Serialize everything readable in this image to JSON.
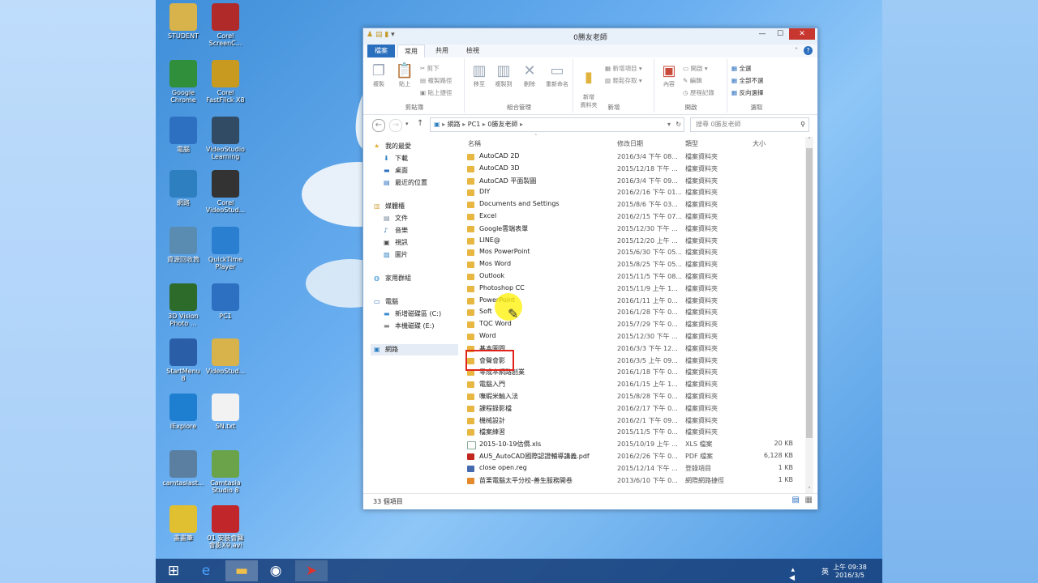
{
  "desktop_icons": [
    {
      "label": "STUDENT",
      "icon": "user-folder-icon",
      "color": "#d8b24a"
    },
    {
      "label": "Corel\nScreenC...",
      "icon": "record-icon",
      "color": "#b02a2a"
    },
    {
      "label": "Google\nChrome",
      "icon": "chrome-icon",
      "color": "#2f8f3a"
    },
    {
      "label": "Corel\nFastFlick X8",
      "icon": "star-icon",
      "color": "#c89b20"
    },
    {
      "label": "電腦",
      "icon": "computer-icon",
      "color": "#2d6fc0"
    },
    {
      "label": "VideoStudio\nLearning",
      "icon": "sb-icon",
      "color": "#324b64"
    },
    {
      "label": "網路",
      "icon": "network-icon",
      "color": "#2d7fc0"
    },
    {
      "label": "Corel\nVideoStud...",
      "icon": "film-reel-icon",
      "color": "#333333"
    },
    {
      "label": "資源回收筒",
      "icon": "recycle-bin-icon",
      "color": "#5a8bb0"
    },
    {
      "label": "QuickTime\nPlayer",
      "icon": "quicktime-icon",
      "color": "#2a7fd0"
    },
    {
      "label": "3D Vision\nPhoto ...",
      "icon": "3d-vision-icon",
      "color": "#2d6b2a"
    },
    {
      "label": "PC1",
      "icon": "pc-icon",
      "color": "#2d6fc0"
    },
    {
      "label": "StartMenu\n8",
      "icon": "windows-icon",
      "color": "#2a5fa8"
    },
    {
      "label": "VideoStud...",
      "icon": "video-file-icon",
      "color": "#d8b24a"
    },
    {
      "label": "IExplore",
      "icon": "ie-icon",
      "color": "#1e7fd0"
    },
    {
      "label": "SN.txt",
      "icon": "text-file-icon",
      "color": "#f2f2f2"
    },
    {
      "label": "camtasiast...",
      "icon": "installer-icon",
      "color": "#5b7fa0"
    },
    {
      "label": "Camtasia\nStudio 8",
      "icon": "camtasia-icon",
      "color": "#6aa34a"
    },
    {
      "label": "畫畫筆",
      "icon": "pencil-icon",
      "color": "#e0c030"
    },
    {
      "label": "01 安裝會聲\n會影X9.avi",
      "icon": "video-icon",
      "color": "#c0262a"
    }
  ],
  "explorer": {
    "title": "0勝友老師",
    "tabs": [
      "檔案",
      "常用",
      "共用",
      "檢視"
    ],
    "ribbon_groups": {
      "clipboard": {
        "name": "剪貼簿",
        "copy": "複製",
        "paste": "貼上",
        "cut": "剪下",
        "copy_path": "複製路徑",
        "paste_shortcut": "貼上捷徑"
      },
      "organize": {
        "name": "組合管理",
        "move_to": "移至",
        "copy_to": "複製到",
        "delete": "刪除",
        "rename": "重新命名"
      },
      "new": {
        "name": "新增",
        "new_folder": "新增\n資料夾",
        "new_item": "新增項目 ▾",
        "easy_access": "輕鬆存取 ▾"
      },
      "open": {
        "name": "開啟",
        "properties": "內容",
        "open": "開啟 ▾",
        "edit": "編輯",
        "history": "歷程記錄"
      },
      "select": {
        "name": "選取",
        "select_all": "全選",
        "select_none": "全部不選",
        "invert": "反向選擇"
      }
    },
    "address": {
      "path": [
        "網路",
        "PC1",
        "0勝友老師"
      ],
      "search_placeholder": "搜尋 0勝友老師"
    },
    "nav_pane": {
      "favorites": "我的最愛",
      "downloads": "下載",
      "desktop": "桌面",
      "recent": "最近的位置",
      "libraries": "媒體櫃",
      "documents": "文件",
      "music": "音樂",
      "videos": "視訊",
      "pictures": "圖片",
      "homegroup": "家用群組",
      "computer": "電腦",
      "drive_c": "新增磁碟區 (C:)",
      "drive_e": "本機磁碟 (E:)",
      "network": "網路"
    },
    "columns": {
      "name": "名稱",
      "date": "修改日期",
      "type": "類型",
      "size": "大小"
    },
    "files": [
      {
        "name": "AutoCAD 2D",
        "date": "2016/3/4 下午 08...",
        "type": "檔案資料夾",
        "size": "",
        "kind": "folder"
      },
      {
        "name": "AutoCAD 3D",
        "date": "2015/12/18 下午 ...",
        "type": "檔案資料夾",
        "size": "",
        "kind": "folder"
      },
      {
        "name": "AutoCAD 平面製圖",
        "date": "2016/3/4 下午 09...",
        "type": "檔案資料夾",
        "size": "",
        "kind": "folder"
      },
      {
        "name": "DIY",
        "date": "2016/2/16 下午 01...",
        "type": "檔案資料夾",
        "size": "",
        "kind": "folder"
      },
      {
        "name": "Documents and Settings",
        "date": "2015/8/6 下午 03...",
        "type": "檔案資料夾",
        "size": "",
        "kind": "folder"
      },
      {
        "name": "Excel",
        "date": "2016/2/15 下午 07...",
        "type": "檔案資料夾",
        "size": "",
        "kind": "folder"
      },
      {
        "name": "Google雲端表單",
        "date": "2015/12/30 下午 ...",
        "type": "檔案資料夾",
        "size": "",
        "kind": "folder"
      },
      {
        "name": "LINE@",
        "date": "2015/12/20 上午 ...",
        "type": "檔案資料夾",
        "size": "",
        "kind": "folder"
      },
      {
        "name": "Mos PowerPoint",
        "date": "2015/6/30 下午 05...",
        "type": "檔案資料夾",
        "size": "",
        "kind": "folder"
      },
      {
        "name": "Mos Word",
        "date": "2015/8/25 下午 05...",
        "type": "檔案資料夾",
        "size": "",
        "kind": "folder"
      },
      {
        "name": "Outlook",
        "date": "2015/11/5 下午 08...",
        "type": "檔案資料夾",
        "size": "",
        "kind": "folder"
      },
      {
        "name": "Photoshop CC",
        "date": "2015/11/9 上午 1...",
        "type": "檔案資料夾",
        "size": "",
        "kind": "folder"
      },
      {
        "name": "PowerPoint",
        "date": "2016/1/11 上午 0...",
        "type": "檔案資料夾",
        "size": "",
        "kind": "folder"
      },
      {
        "name": "Soft",
        "date": "2016/1/28 下午 0...",
        "type": "檔案資料夾",
        "size": "",
        "kind": "folder"
      },
      {
        "name": "TQC Word",
        "date": "2015/7/29 下午 0...",
        "type": "檔案資料夾",
        "size": "",
        "kind": "folder"
      },
      {
        "name": "Word",
        "date": "2015/12/30 下午 ...",
        "type": "檔案資料夾",
        "size": "",
        "kind": "folder"
      },
      {
        "name": "基本圖問",
        "date": "2016/3/3 下午 12...",
        "type": "檔案資料夾",
        "size": "",
        "kind": "folder"
      },
      {
        "name": "會聲會影",
        "date": "2016/3/5 上午 09...",
        "type": "檔案資料夾",
        "size": "",
        "kind": "folder"
      },
      {
        "name": "零成本網路創業",
        "date": "2016/1/18 下午 0...",
        "type": "檔案資料夾",
        "size": "",
        "kind": "folder"
      },
      {
        "name": "電腦入門",
        "date": "2016/1/15 上午 1...",
        "type": "檔案資料夾",
        "size": "",
        "kind": "folder"
      },
      {
        "name": "嘸蝦米輸入法",
        "date": "2015/8/28 下午 0...",
        "type": "檔案資料夾",
        "size": "",
        "kind": "folder"
      },
      {
        "name": "課程錄影檔",
        "date": "2016/2/17 下午 0...",
        "type": "檔案資料夾",
        "size": "",
        "kind": "folder"
      },
      {
        "name": "機械設計",
        "date": "2016/2/1 下午 09...",
        "type": "檔案資料夾",
        "size": "",
        "kind": "folder"
      },
      {
        "name": "檔案練習",
        "date": "2015/11/5 下午 0...",
        "type": "檔案資料夾",
        "size": "",
        "kind": "folder"
      },
      {
        "name": "2015-10-19估價.xls",
        "date": "2015/10/19 上午 ...",
        "type": "XLS 檔案",
        "size": "20 KB",
        "kind": "xls"
      },
      {
        "name": "AU5_AutoCAD國際認證輔導講義.pdf",
        "date": "2016/2/26 下午 0...",
        "type": "PDF 檔案",
        "size": "6,128 KB",
        "kind": "pdf"
      },
      {
        "name": "close open.reg",
        "date": "2015/12/14 下午 ...",
        "type": "登錄項目",
        "size": "1 KB",
        "kind": "reg"
      },
      {
        "name": "苗栗電腦太平分校-善生服務開卷",
        "date": "2013/6/10 下午 0...",
        "type": "網際網路捷徑",
        "size": "1 KB",
        "kind": "url"
      }
    ],
    "status": "33 個項目"
  },
  "taskbar": {
    "time": "上午 09:38",
    "date": "2016/3/5",
    "ime": "英"
  },
  "colors": {
    "accent": "#2a6ebe",
    "highlight_box": "#e0241b",
    "cursor_spot": "#fff000",
    "folder": "#e7b741"
  }
}
